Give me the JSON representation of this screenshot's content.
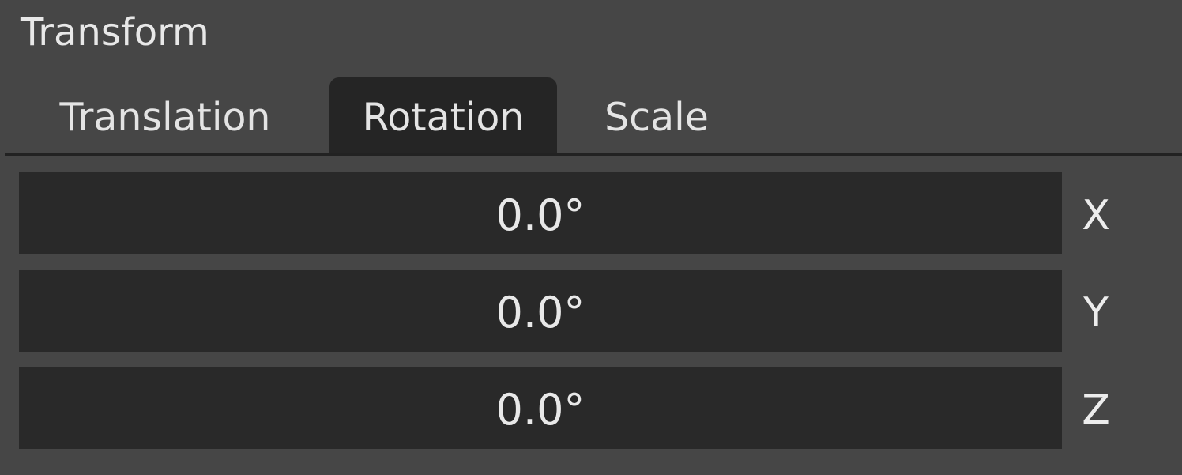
{
  "panel": {
    "title": "Transform"
  },
  "tabs": [
    {
      "label": "Translation",
      "active": false
    },
    {
      "label": "Rotation",
      "active": true
    },
    {
      "label": "Scale",
      "active": false
    }
  ],
  "fields": [
    {
      "axis": "X",
      "value": "0.0°"
    },
    {
      "axis": "Y",
      "value": "0.0°"
    },
    {
      "axis": "Z",
      "value": "0.0°"
    }
  ],
  "colors": {
    "panel_bg": "#464646",
    "tab_active_bg": "#252525",
    "field_bg": "#292929",
    "text": "#e6e6e6"
  }
}
